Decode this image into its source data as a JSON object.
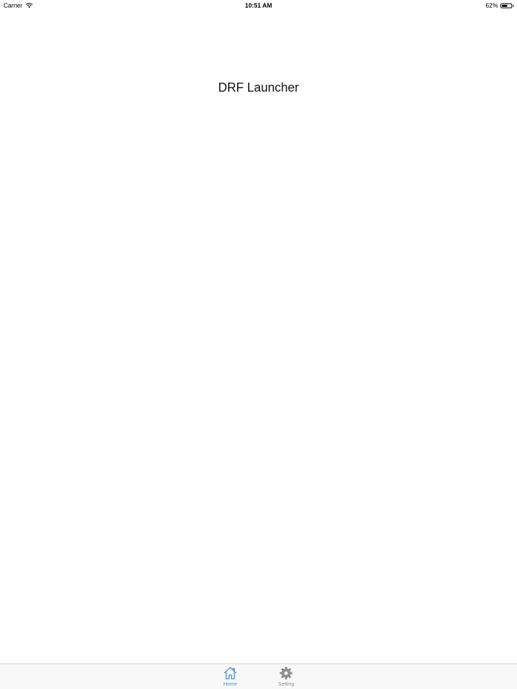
{
  "status_bar": {
    "carrier": "Carrier",
    "time": "10:51 AM",
    "battery_percent_label": "62%",
    "battery_level": 0.62,
    "icons": [
      "wifi-icon",
      "battery-icon"
    ]
  },
  "nav": {
    "title": "DRF Launcher"
  },
  "tab_bar": {
    "items": [
      {
        "label": "Home",
        "icon": "house-icon",
        "selected": true
      },
      {
        "label": "Setting",
        "icon": "gear-icon",
        "selected": false
      }
    ]
  },
  "colors": {
    "accent": "#3d8fe0",
    "inactive": "#8e8e93",
    "tab_bar_bg": "#f8f8f8",
    "background": "#ffffff"
  }
}
